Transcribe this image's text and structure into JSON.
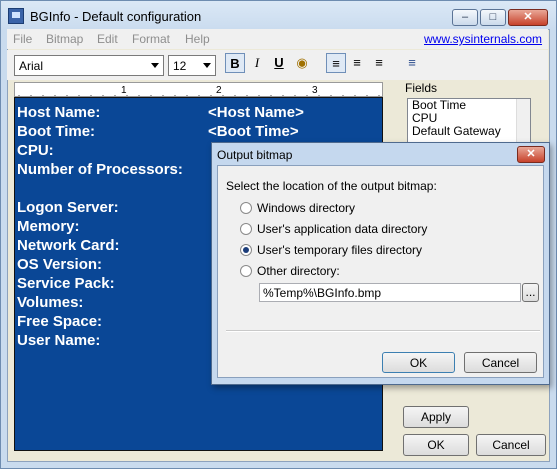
{
  "app": {
    "title": "BGInfo - Default configuration",
    "link": "www.sysinternals.com"
  },
  "menu": [
    "File",
    "Bitmap",
    "Edit",
    "Format",
    "Help"
  ],
  "toolbar": {
    "font": "Arial",
    "size": "12",
    "bold": "B",
    "italic": "I",
    "underline": "U"
  },
  "editor": {
    "labels": [
      "Host Name:",
      "Boot Time:",
      "CPU:",
      "Number of Processors:",
      "Logon Server:",
      "Memory:",
      "Network Card:",
      "OS Version:",
      "Service Pack:",
      "Volumes:",
      "Free Space:",
      "User Name:"
    ],
    "values": [
      "<Host Name>",
      "<Boot Time>"
    ]
  },
  "fields": {
    "label": "Fields",
    "items": [
      "Boot Time",
      "CPU",
      "Default Gateway"
    ]
  },
  "buttons": {
    "apply": "Apply",
    "ok": "OK",
    "cancel": "Cancel"
  },
  "dialog": {
    "title": "Output bitmap",
    "prompt": "Select the location of the output bitmap:",
    "options": [
      "Windows directory",
      "User's application data directory",
      "User's temporary files directory",
      "Other directory:"
    ],
    "selected_index": 2,
    "path": "%Temp%\\BGInfo.bmp",
    "browse": "...",
    "ok": "OK",
    "cancel": "Cancel"
  }
}
